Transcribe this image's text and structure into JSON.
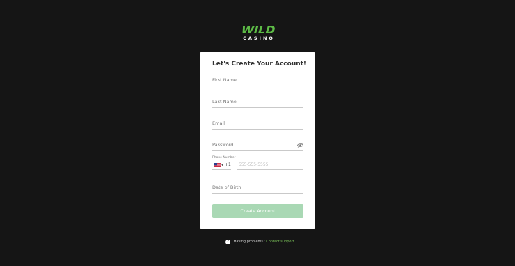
{
  "brand": {
    "logo_top": "WILD",
    "logo_bottom": "CASINO",
    "accent_color": "#5dbb46"
  },
  "form": {
    "title": "Let's Create Your Account!",
    "fields": {
      "first_name": {
        "placeholder": "First Name"
      },
      "last_name": {
        "placeholder": "Last Name"
      },
      "email": {
        "placeholder": "Email"
      },
      "password": {
        "placeholder": "Password",
        "icon": "eye-off-icon"
      },
      "phone": {
        "label": "Phone Number",
        "country_flag": "us-flag-icon",
        "dial_code": "+1",
        "placeholder": "555-555-5555"
      },
      "dob": {
        "placeholder": "Date of Birth"
      }
    },
    "submit_label": "Create Account",
    "submit_color": "#a9d8b4"
  },
  "footer": {
    "help_text": "Having problems?",
    "link_text": "Contact support",
    "link_color": "#7cc45a"
  }
}
